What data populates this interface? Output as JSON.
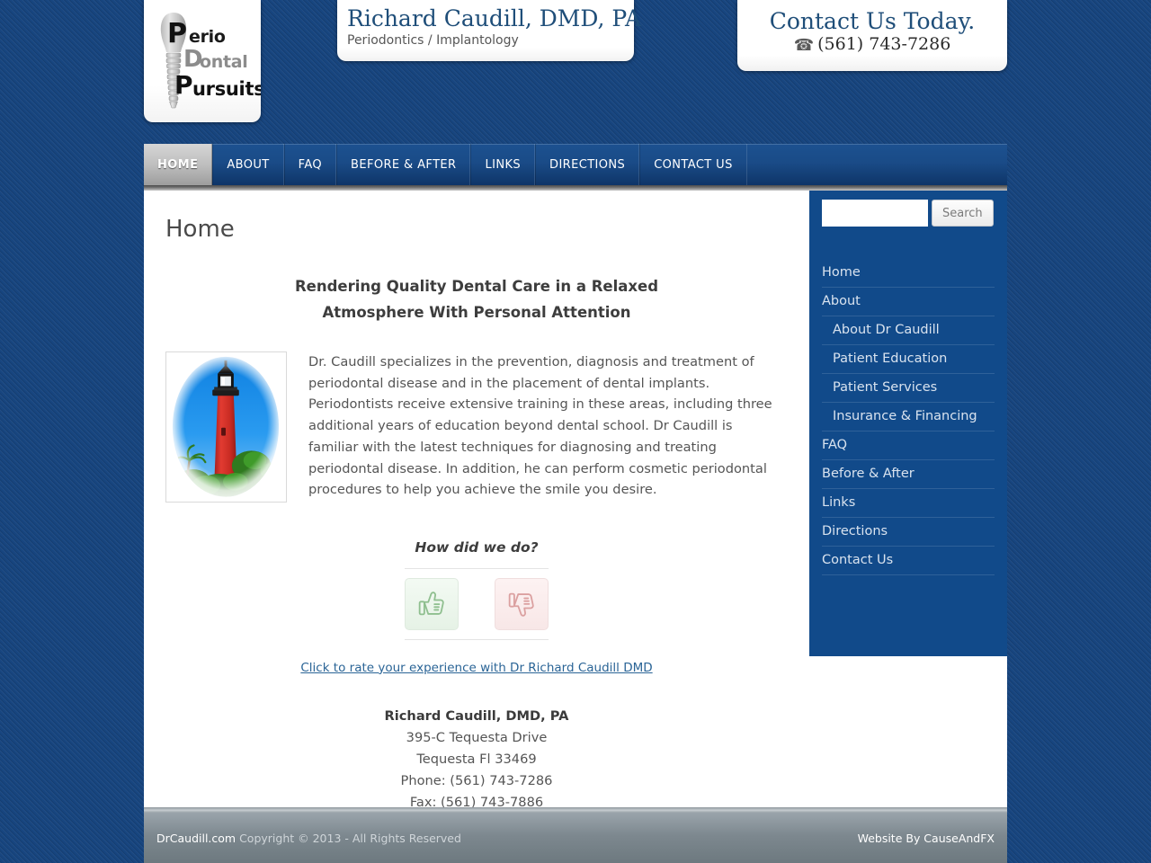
{
  "header": {
    "logo": {
      "line1_cap": "P",
      "line1_rest": "erio",
      "line2_cap": "D",
      "line2_rest": "ontal",
      "line3_cap": "P",
      "line3_rest": "ursuits",
      "alt": "Perio Dontal Pursuits"
    },
    "practice_name": "Richard Caudill, DMD, PA",
    "specialty": "Periodontics / Implantology",
    "contact_heading": "Contact Us Today.",
    "contact_phone": "(561) 743-7286",
    "phone_icon": "telephone-icon"
  },
  "nav": {
    "items": [
      {
        "label": "HOME",
        "active": true
      },
      {
        "label": "ABOUT",
        "active": false
      },
      {
        "label": "FAQ",
        "active": false
      },
      {
        "label": "BEFORE & AFTER",
        "active": false
      },
      {
        "label": "LINKS",
        "active": false
      },
      {
        "label": "DIRECTIONS",
        "active": false
      },
      {
        "label": "CONTACT US",
        "active": false
      }
    ]
  },
  "main": {
    "page_title": "Home",
    "tagline_line1": "Rendering Quality Dental Care in a Relaxed",
    "tagline_line2": "Atmosphere With Personal Attention",
    "image_alt": "Jupiter Inlet Lighthouse",
    "intro_paragraph": "Dr. Caudill specializes in the prevention, diagnosis and treatment of periodontal disease and in the placement of dental implants.  Periodontists receive extensive training in these areas, including three additional years of education beyond dental school.  Dr Caudill is familiar with the latest techniques for diagnosing and treating periodontal disease.  In addition, he can perform cosmetic periodontal procedures to help you achieve the smile you desire.",
    "rating_heading": "How did we do?",
    "thumb_up_icon": "thumbs-up-icon",
    "thumb_down_icon": "thumbs-down-icon",
    "rate_link": "Click to rate your experience with Dr Richard Caudill DMD",
    "address": {
      "name": "Richard Caudill, DMD, PA",
      "street": "395-C Tequesta Drive",
      "city_state_zip": "Tequesta Fl 33469",
      "phone": "Phone: (561) 743-7286",
      "fax": "Fax: (561) 743-7886"
    }
  },
  "sidebar": {
    "search_value": "",
    "search_placeholder": "",
    "search_button": "Search",
    "menu": [
      {
        "label": "Home",
        "sub": false
      },
      {
        "label": "About",
        "sub": false
      },
      {
        "label": "About Dr Caudill",
        "sub": true
      },
      {
        "label": "Patient Education",
        "sub": true
      },
      {
        "label": "Patient Services",
        "sub": true
      },
      {
        "label": "Insurance & Financing",
        "sub": true
      },
      {
        "label": "FAQ",
        "sub": false
      },
      {
        "label": "Before & After",
        "sub": false
      },
      {
        "label": "Links",
        "sub": false
      },
      {
        "label": "Directions",
        "sub": false
      },
      {
        "label": "Contact Us",
        "sub": false
      }
    ]
  },
  "footer": {
    "site_link": "DrCaudill.com",
    "copyright": " Copyright © 2013 - All Rights Reserved",
    "credit": "Website By CauseAndFX"
  },
  "colors": {
    "page_background": "#17457f",
    "nav_blue": "#1a4b87",
    "sidebar_blue": "#114a8a",
    "brand_serif_blue": "#1f4e79",
    "link_blue": "#2a6496",
    "footer_gray": "#7d888f",
    "thumb_up_green": "#8fbf8f",
    "thumb_down_red": "#dba0a0"
  }
}
